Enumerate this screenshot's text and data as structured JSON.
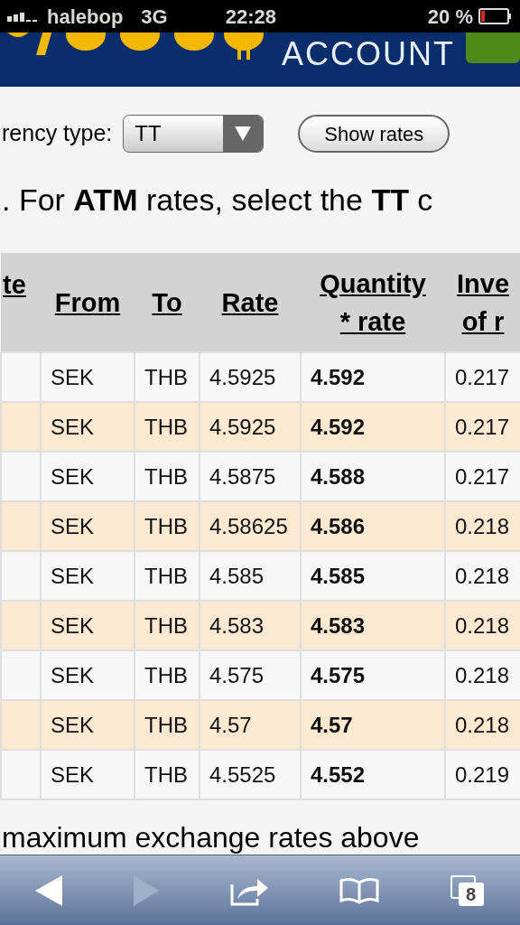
{
  "status_bar": {
    "carrier": "halebop",
    "network": "3G",
    "time": "22:28",
    "battery": "20 %"
  },
  "banner": {
    "title": "ACCOUNT"
  },
  "form": {
    "label": "rency type:",
    "select_value": "TT",
    "button": "Show rates"
  },
  "note": ". For **ATM** rates, select the **TT** c",
  "table": {
    "columns": [
      "te",
      "From",
      "To",
      "Rate",
      "Quantity\n* rate",
      "Inve\nof r"
    ],
    "rows": [
      [
        "",
        "SEK",
        "THB",
        "4.5925",
        "4.592",
        "0.217"
      ],
      [
        "",
        "SEK",
        "THB",
        "4.5925",
        "4.592",
        "0.217"
      ],
      [
        "",
        "SEK",
        "THB",
        "4.5875",
        "4.588",
        "0.217"
      ],
      [
        "",
        "SEK",
        "THB",
        "4.58625",
        "4.586",
        "0.218"
      ],
      [
        "",
        "SEK",
        "THB",
        "4.585",
        "4.585",
        "0.218"
      ],
      [
        "",
        "SEK",
        "THB",
        "4.583",
        "4.583",
        "0.218"
      ],
      [
        "",
        "SEK",
        "THB",
        "4.575",
        "4.575",
        "0.218"
      ],
      [
        "",
        "SEK",
        "THB",
        "4.57",
        "4.57",
        "0.218"
      ],
      [
        "",
        "SEK",
        "THB",
        "4.5525",
        "4.552",
        "0.219"
      ]
    ]
  },
  "footer_text": "maximum exchange rates above",
  "toolbar": {
    "tab_count": "8"
  }
}
